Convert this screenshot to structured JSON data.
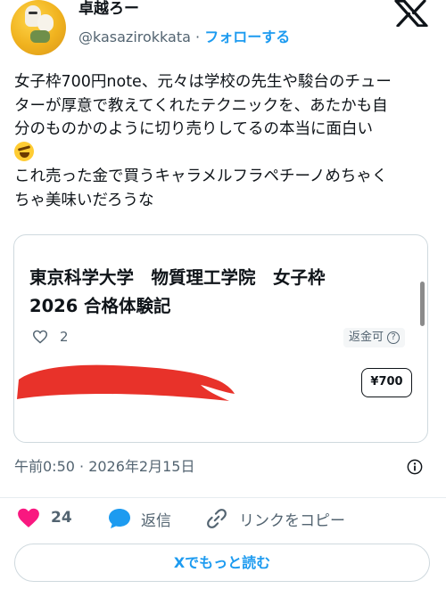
{
  "author": {
    "display_name": "卓越ろー",
    "handle": "@kasazirokkata",
    "separator": "·",
    "follow_label": "フォローする"
  },
  "tweet": {
    "lines": [
      "女子枠700円note、元々は学校の先生や駿台のチュー",
      "ターが厚意で教えてくれたテクニックを、あたかも自",
      "分のものかのように切り売りしてるの本当に面白い",
      "これ売った金で買うキャラメルフラペチーノめちゃく",
      "ちゃ美味いだろうな"
    ],
    "emoji_icon": "rofl-emoji-icon"
  },
  "card": {
    "title_lines": [
      "東京科学大学　物質理工学院　女子枠",
      "2026 合格体験記"
    ],
    "like_count": "2",
    "refund_label": "返金可",
    "refund_help": "?",
    "price": "¥700"
  },
  "meta": {
    "timestamp": "午前0:50 · 2026年2月15日"
  },
  "actions": {
    "like_count": "24",
    "reply_label": "返信",
    "copy_link_label": "リンクをコピー"
  },
  "read_more_label": "Xでもっと読む",
  "colors": {
    "accent": "#1d9bf0",
    "like": "#f91880",
    "reply": "#1d9bf0",
    "redaction": "#e8322a",
    "text": "#0f1419",
    "muted": "#536471"
  }
}
